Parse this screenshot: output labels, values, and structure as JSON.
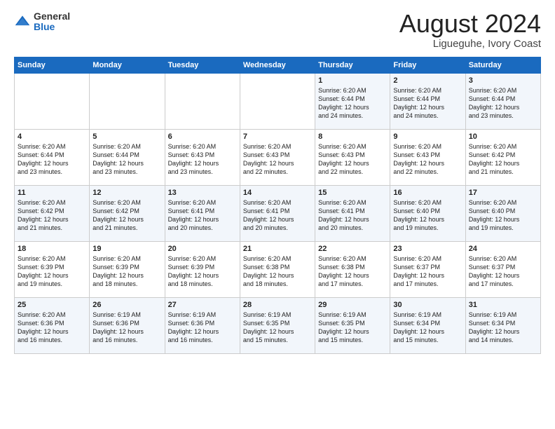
{
  "logo": {
    "general": "General",
    "blue": "Blue"
  },
  "header": {
    "month": "August 2024",
    "location": "Ligueguhe, Ivory Coast"
  },
  "weekdays": [
    "Sunday",
    "Monday",
    "Tuesday",
    "Wednesday",
    "Thursday",
    "Friday",
    "Saturday"
  ],
  "weeks": [
    [
      {
        "day": "",
        "info": ""
      },
      {
        "day": "",
        "info": ""
      },
      {
        "day": "",
        "info": ""
      },
      {
        "day": "",
        "info": ""
      },
      {
        "day": "1",
        "info": "Sunrise: 6:20 AM\nSunset: 6:44 PM\nDaylight: 12 hours\nand 24 minutes."
      },
      {
        "day": "2",
        "info": "Sunrise: 6:20 AM\nSunset: 6:44 PM\nDaylight: 12 hours\nand 24 minutes."
      },
      {
        "day": "3",
        "info": "Sunrise: 6:20 AM\nSunset: 6:44 PM\nDaylight: 12 hours\nand 23 minutes."
      }
    ],
    [
      {
        "day": "4",
        "info": "Sunrise: 6:20 AM\nSunset: 6:44 PM\nDaylight: 12 hours\nand 23 minutes."
      },
      {
        "day": "5",
        "info": "Sunrise: 6:20 AM\nSunset: 6:44 PM\nDaylight: 12 hours\nand 23 minutes."
      },
      {
        "day": "6",
        "info": "Sunrise: 6:20 AM\nSunset: 6:43 PM\nDaylight: 12 hours\nand 23 minutes."
      },
      {
        "day": "7",
        "info": "Sunrise: 6:20 AM\nSunset: 6:43 PM\nDaylight: 12 hours\nand 22 minutes."
      },
      {
        "day": "8",
        "info": "Sunrise: 6:20 AM\nSunset: 6:43 PM\nDaylight: 12 hours\nand 22 minutes."
      },
      {
        "day": "9",
        "info": "Sunrise: 6:20 AM\nSunset: 6:43 PM\nDaylight: 12 hours\nand 22 minutes."
      },
      {
        "day": "10",
        "info": "Sunrise: 6:20 AM\nSunset: 6:42 PM\nDaylight: 12 hours\nand 21 minutes."
      }
    ],
    [
      {
        "day": "11",
        "info": "Sunrise: 6:20 AM\nSunset: 6:42 PM\nDaylight: 12 hours\nand 21 minutes."
      },
      {
        "day": "12",
        "info": "Sunrise: 6:20 AM\nSunset: 6:42 PM\nDaylight: 12 hours\nand 21 minutes."
      },
      {
        "day": "13",
        "info": "Sunrise: 6:20 AM\nSunset: 6:41 PM\nDaylight: 12 hours\nand 20 minutes."
      },
      {
        "day": "14",
        "info": "Sunrise: 6:20 AM\nSunset: 6:41 PM\nDaylight: 12 hours\nand 20 minutes."
      },
      {
        "day": "15",
        "info": "Sunrise: 6:20 AM\nSunset: 6:41 PM\nDaylight: 12 hours\nand 20 minutes."
      },
      {
        "day": "16",
        "info": "Sunrise: 6:20 AM\nSunset: 6:40 PM\nDaylight: 12 hours\nand 19 minutes."
      },
      {
        "day": "17",
        "info": "Sunrise: 6:20 AM\nSunset: 6:40 PM\nDaylight: 12 hours\nand 19 minutes."
      }
    ],
    [
      {
        "day": "18",
        "info": "Sunrise: 6:20 AM\nSunset: 6:39 PM\nDaylight: 12 hours\nand 19 minutes."
      },
      {
        "day": "19",
        "info": "Sunrise: 6:20 AM\nSunset: 6:39 PM\nDaylight: 12 hours\nand 18 minutes."
      },
      {
        "day": "20",
        "info": "Sunrise: 6:20 AM\nSunset: 6:39 PM\nDaylight: 12 hours\nand 18 minutes."
      },
      {
        "day": "21",
        "info": "Sunrise: 6:20 AM\nSunset: 6:38 PM\nDaylight: 12 hours\nand 18 minutes."
      },
      {
        "day": "22",
        "info": "Sunrise: 6:20 AM\nSunset: 6:38 PM\nDaylight: 12 hours\nand 17 minutes."
      },
      {
        "day": "23",
        "info": "Sunrise: 6:20 AM\nSunset: 6:37 PM\nDaylight: 12 hours\nand 17 minutes."
      },
      {
        "day": "24",
        "info": "Sunrise: 6:20 AM\nSunset: 6:37 PM\nDaylight: 12 hours\nand 17 minutes."
      }
    ],
    [
      {
        "day": "25",
        "info": "Sunrise: 6:20 AM\nSunset: 6:36 PM\nDaylight: 12 hours\nand 16 minutes."
      },
      {
        "day": "26",
        "info": "Sunrise: 6:19 AM\nSunset: 6:36 PM\nDaylight: 12 hours\nand 16 minutes."
      },
      {
        "day": "27",
        "info": "Sunrise: 6:19 AM\nSunset: 6:36 PM\nDaylight: 12 hours\nand 16 minutes."
      },
      {
        "day": "28",
        "info": "Sunrise: 6:19 AM\nSunset: 6:35 PM\nDaylight: 12 hours\nand 15 minutes."
      },
      {
        "day": "29",
        "info": "Sunrise: 6:19 AM\nSunset: 6:35 PM\nDaylight: 12 hours\nand 15 minutes."
      },
      {
        "day": "30",
        "info": "Sunrise: 6:19 AM\nSunset: 6:34 PM\nDaylight: 12 hours\nand 15 minutes."
      },
      {
        "day": "31",
        "info": "Sunrise: 6:19 AM\nSunset: 6:34 PM\nDaylight: 12 hours\nand 14 minutes."
      }
    ]
  ]
}
